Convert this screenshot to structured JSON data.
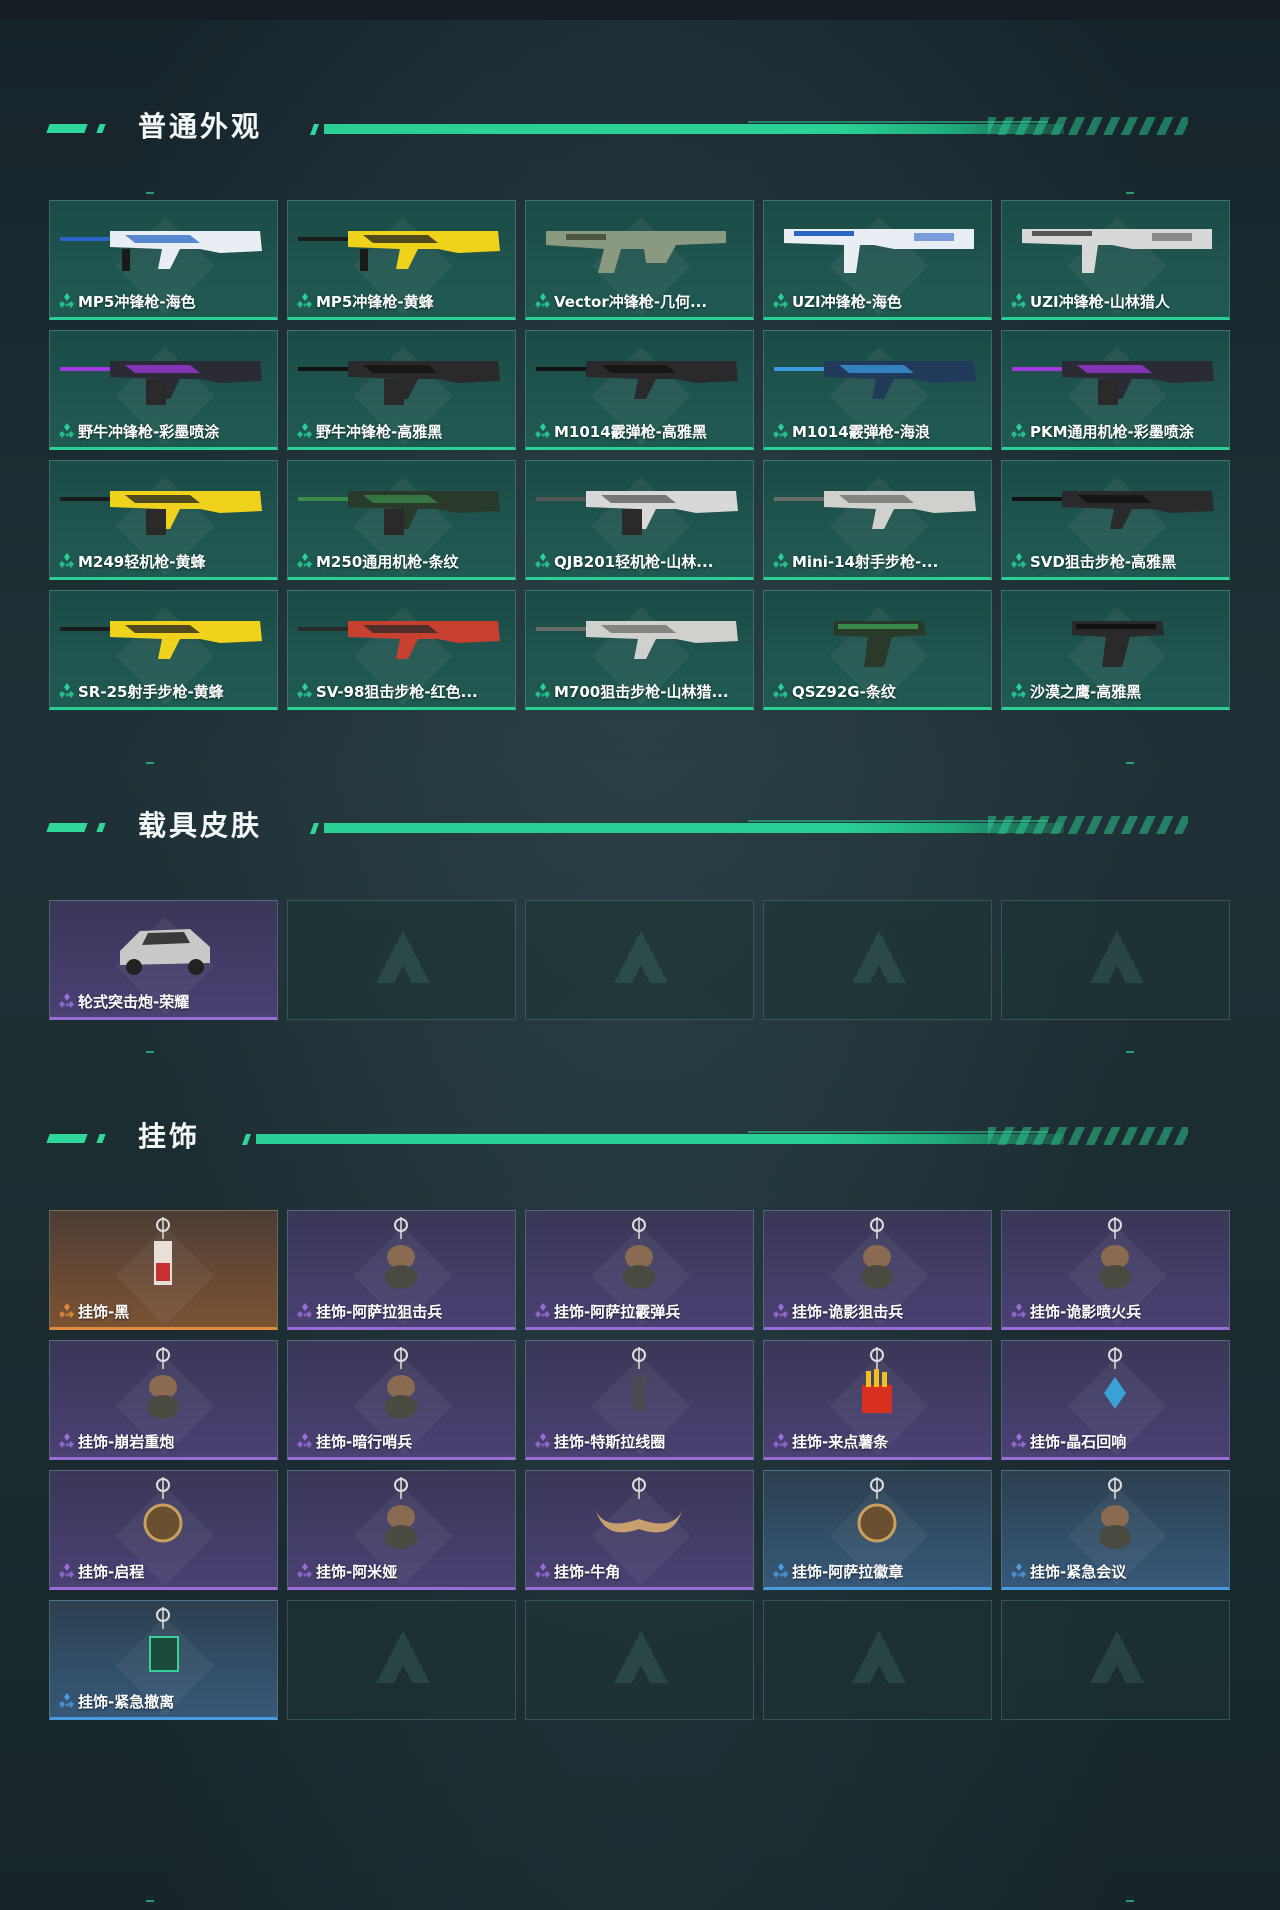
{
  "sections": {
    "skins": {
      "title": "普通外观",
      "items": [
        {
          "label": "MP5冲锋枪-海色",
          "rarity": "green",
          "art": "smg-white-blue"
        },
        {
          "label": "MP5冲锋枪-黄蜂",
          "rarity": "green",
          "art": "smg-yellow"
        },
        {
          "label": "Vector冲锋枪-几何...",
          "rarity": "green",
          "art": "vector-camo"
        },
        {
          "label": "UZI冲锋枪-海色",
          "rarity": "green",
          "art": "uzi-white-blue"
        },
        {
          "label": "UZI冲锋枪-山林猎人",
          "rarity": "green",
          "art": "uzi-white-gray"
        },
        {
          "label": "野牛冲锋枪-彩墨喷涂",
          "rarity": "green",
          "art": "bizon-purple"
        },
        {
          "label": "野牛冲锋枪-高雅黑",
          "rarity": "green",
          "art": "bizon-black"
        },
        {
          "label": "M1014霰弹枪-高雅黑",
          "rarity": "green",
          "art": "shotgun-black"
        },
        {
          "label": "M1014霰弹枪-海浪",
          "rarity": "green",
          "art": "shotgun-blue"
        },
        {
          "label": "PKM通用机枪-彩墨喷涂",
          "rarity": "green",
          "art": "pkm-purple"
        },
        {
          "label": "M249轻机枪-黄蜂",
          "rarity": "green",
          "art": "lmg-yellow"
        },
        {
          "label": "M250通用机枪-条纹",
          "rarity": "green",
          "art": "lmg-green"
        },
        {
          "label": "QJB201轻机枪-山林...",
          "rarity": "green",
          "art": "lmg-white-gray"
        },
        {
          "label": "Mini-14射手步枪-...",
          "rarity": "green",
          "art": "rifle-white"
        },
        {
          "label": "SVD狙击步枪-高雅黑",
          "rarity": "green",
          "art": "svd-black"
        },
        {
          "label": "SR-25射手步枪-黄蜂",
          "rarity": "green",
          "art": "rifle-yellow"
        },
        {
          "label": "SV-98狙击步枪-红色...",
          "rarity": "green",
          "art": "sniper-red"
        },
        {
          "label": "M700狙击步枪-山林猎...",
          "rarity": "green",
          "art": "sniper-white"
        },
        {
          "label": "QSZ92G-条纹",
          "rarity": "green",
          "art": "pistol-green"
        },
        {
          "label": "沙漠之鹰-高雅黑",
          "rarity": "green",
          "art": "pistol-black"
        }
      ]
    },
    "vehicles": {
      "title": "载具皮肤",
      "items": [
        {
          "label": "轮式突击炮-荣耀",
          "rarity": "purple",
          "art": "vehicle-buggy"
        }
      ]
    },
    "charms": {
      "title": "挂饰",
      "items": [
        {
          "label": "挂饰-黑",
          "rarity": "orange",
          "art": "charm-black"
        },
        {
          "label": "挂饰-阿萨拉狙击兵",
          "rarity": "purple",
          "art": "charm-figure"
        },
        {
          "label": "挂饰-阿萨拉霰弹兵",
          "rarity": "purple",
          "art": "charm-figure"
        },
        {
          "label": "挂饰-诡影狙击兵",
          "rarity": "purple",
          "art": "charm-figure"
        },
        {
          "label": "挂饰-诡影喷火兵",
          "rarity": "purple",
          "art": "charm-figure"
        },
        {
          "label": "挂饰-崩岩重炮",
          "rarity": "purple",
          "art": "charm-figure"
        },
        {
          "label": "挂饰-暗行哨兵",
          "rarity": "purple",
          "art": "charm-figure"
        },
        {
          "label": "挂饰-特斯拉线圈",
          "rarity": "purple",
          "art": "charm-ring"
        },
        {
          "label": "挂饰-来点薯条",
          "rarity": "purple",
          "art": "charm-fries"
        },
        {
          "label": "挂饰-晶石回响",
          "rarity": "purple",
          "art": "charm-crystal"
        },
        {
          "label": "挂饰-启程",
          "rarity": "purple",
          "art": "charm-medal"
        },
        {
          "label": "挂饰-阿米娅",
          "rarity": "purple",
          "art": "charm-figure"
        },
        {
          "label": "挂饰-牛角",
          "rarity": "purple",
          "art": "charm-horns"
        },
        {
          "label": "挂饰-阿萨拉徽章",
          "rarity": "blue",
          "art": "charm-medal"
        },
        {
          "label": "挂饰-紧急会议",
          "rarity": "blue",
          "art": "charm-figure"
        },
        {
          "label": "挂饰-紧急撤离",
          "rarity": "blue",
          "art": "charm-box"
        }
      ]
    }
  },
  "colors": {
    "accent": "#2ad095",
    "green": "#2ad095",
    "purple": "#9a6cd8",
    "orange": "#e08a3c",
    "blue": "#4a9ae0"
  }
}
